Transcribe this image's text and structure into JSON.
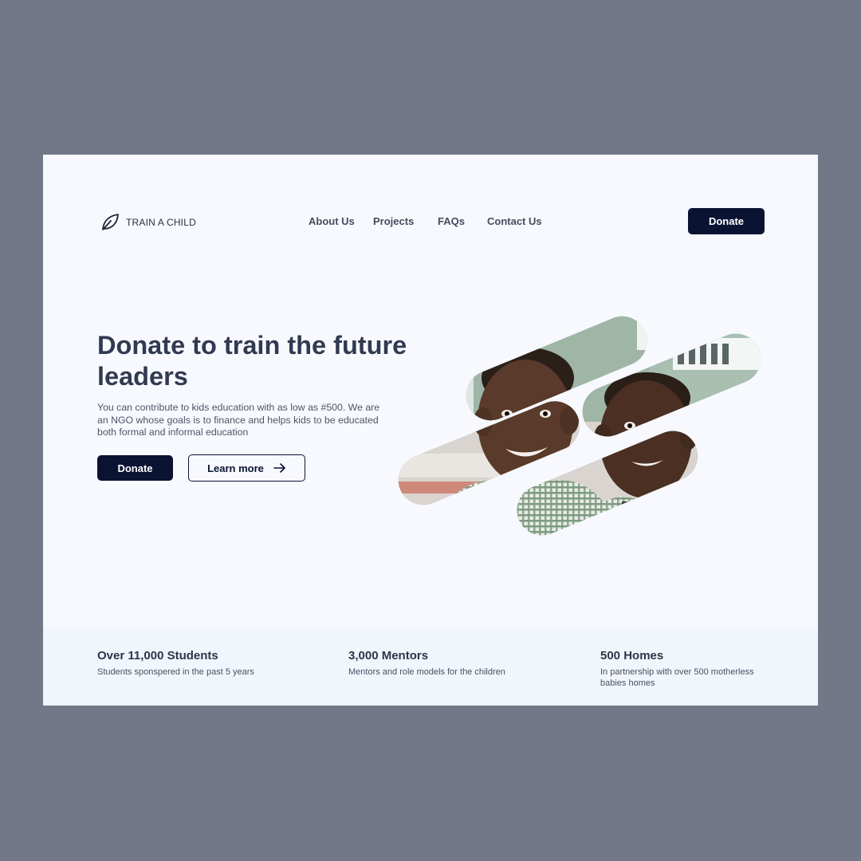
{
  "brand": {
    "name": "TRAIN A CHILD",
    "logo_icon": "leaf-icon"
  },
  "nav": {
    "links": [
      "About Us",
      "Projects",
      "FAQs",
      "Contact Us"
    ],
    "donate_label": "Donate"
  },
  "hero": {
    "title": "Donate to train the future leaders",
    "description": "You can contribute to kids education with as low as #500. We are an NGO whose goals is to finance and helps kids to be educated both formal and informal education",
    "donate_label": "Donate",
    "learn_more_label": "Learn more",
    "learn_more_icon": "arrow-right-icon"
  },
  "stats": [
    {
      "title": "Over 11,000 Students",
      "description": "Students sponspered in the past 5 years"
    },
    {
      "title": "3,000 Mentors",
      "description": "Mentors and role models for the children"
    },
    {
      "title": "500 Homes",
      "description": "In partnership with over 500 motherless babies homes"
    }
  ],
  "colors": {
    "page_background": "#737889",
    "card_background": "#f7f9fe",
    "stats_background": "#f1f5fc",
    "primary": "#0b1333",
    "heading": "#323a52",
    "body_text": "#4e5466"
  }
}
